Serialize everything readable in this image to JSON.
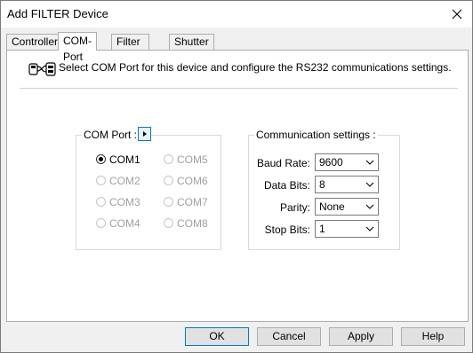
{
  "window": {
    "title": "Add FILTER Device"
  },
  "tabs": [
    {
      "label": "Controller"
    },
    {
      "label": "COM-Port"
    },
    {
      "label": "Filter Setup"
    },
    {
      "label": "Shutter Setup"
    }
  ],
  "info": {
    "text": "Select COM Port for this device and configure the RS232 communications settings.",
    "icon": "serial-connection-icon"
  },
  "com_port": {
    "legend": "COM Port :",
    "options": [
      {
        "label": "COM1",
        "checked": true,
        "enabled": true
      },
      {
        "label": "COM2",
        "checked": false,
        "enabled": false
      },
      {
        "label": "COM3",
        "checked": false,
        "enabled": false
      },
      {
        "label": "COM4",
        "checked": false,
        "enabled": false
      },
      {
        "label": "COM5",
        "checked": false,
        "enabled": false
      },
      {
        "label": "COM6",
        "checked": false,
        "enabled": false
      },
      {
        "label": "COM7",
        "checked": false,
        "enabled": false
      },
      {
        "label": "COM8",
        "checked": false,
        "enabled": false
      }
    ]
  },
  "comm": {
    "legend": "Communication settings :",
    "baud_label": "Baud Rate:",
    "baud_value": "9600",
    "databits_label": "Data Bits:",
    "databits_value": "8",
    "parity_label": "Parity:",
    "parity_value": "None",
    "stopbits_label": "Stop Bits:",
    "stopbits_value": "1"
  },
  "buttons": {
    "ok": "OK",
    "cancel": "Cancel",
    "apply": "Apply",
    "help": "Help"
  },
  "colors": {
    "accent": "#0078d7"
  }
}
